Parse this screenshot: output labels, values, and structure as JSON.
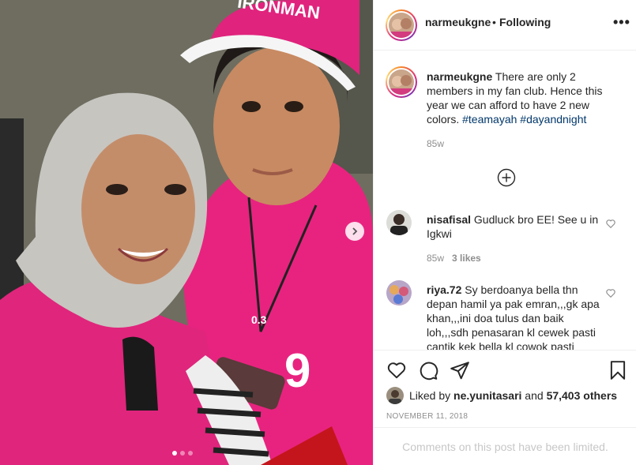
{
  "post": {
    "username": "narmeukgne",
    "follow_separator": "•",
    "follow_status": "Following",
    "more_label": "•••"
  },
  "caption": {
    "username": "narmeukgne",
    "text": " There are only 2 members in my fan club. Hence this year we can afford to have 2 new colors. ",
    "hashtags": [
      "#teamayah",
      "#dayandnight"
    ],
    "time": "85w"
  },
  "comments": [
    {
      "username": "nisafisal",
      "text": " Gudluck bro EE! See u in Igkwi",
      "time": "85w",
      "likes": "3 likes"
    },
    {
      "username": "riya.72",
      "text": " Sy berdoanya bella thn depan hamil ya pak emran,,,gk apa khan,,,ini doa tulus dan baik loh,,,sdh penasaran kl cewek pasti cantik kek bella kl cowok pasti"
    }
  ],
  "likes": {
    "prefix": "Liked by ",
    "liker": "ne.yunitasari",
    "middle": " and ",
    "count": "57,403 others"
  },
  "date": "NOVEMBER 11, 2018",
  "comments_limited": "Comments on this post have been limited.",
  "colors": {
    "pink": "#e6187a",
    "link": "#00376b",
    "muted": "#8e8e8e"
  }
}
